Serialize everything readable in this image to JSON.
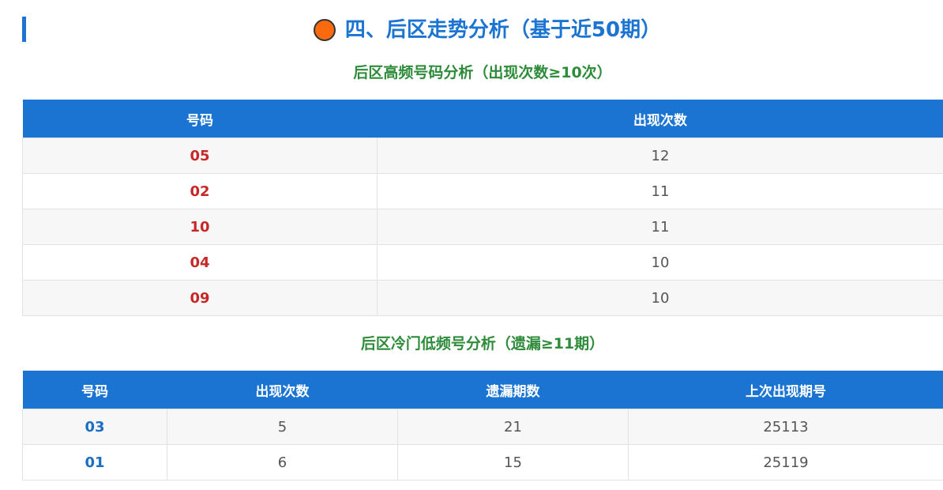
{
  "section": {
    "title": "四、后区走势分析（基于近50期）",
    "accent_color": "#1b74d1",
    "dot_color": "#fb6a0e"
  },
  "hot": {
    "title": "后区高频号码分析（出现次数≥10次）",
    "headers": [
      "号码",
      "出现次数"
    ],
    "rows": [
      {
        "number": "05",
        "count": "12"
      },
      {
        "number": "02",
        "count": "11"
      },
      {
        "number": "10",
        "count": "11"
      },
      {
        "number": "04",
        "count": "10"
      },
      {
        "number": "09",
        "count": "10"
      }
    ]
  },
  "cold": {
    "title": "后区冷门低频号分析（遗漏≥11期）",
    "headers": [
      "号码",
      "出现次数",
      "遗漏期数",
      "上次出现期号"
    ],
    "rows": [
      {
        "number": "03",
        "count": "5",
        "missed": "21",
        "last_issue": "25113"
      },
      {
        "number": "01",
        "count": "6",
        "missed": "15",
        "last_issue": "25119"
      }
    ]
  }
}
